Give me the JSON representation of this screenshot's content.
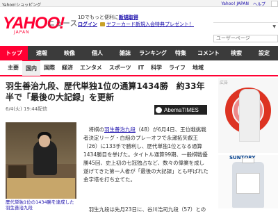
{
  "topbar": {
    "left_text": "Yahoo!ショッピング",
    "right_links": [
      "Yahoo! JAPAN",
      "ヘルプ"
    ]
  },
  "header": {
    "logo": "YAHOO!",
    "logo_sub": "JAPAN",
    "service_name": "ニュース",
    "promo_line1_prefix": "1Dでもっと便利に",
    "promo_line1_link": "新規取得",
    "promo_line2_link": "ログイン",
    "promo_line2_text": "ヤフーカード新規入会特典プレゼント！",
    "user_dropdown": "",
    "user_input_placeholder": "ユーザーページ"
  },
  "nav": {
    "items": [
      "トップ",
      "速報",
      "映像",
      "個人",
      "雑誌",
      "ランキング",
      "特集",
      "コメント",
      "検索",
      "設定"
    ],
    "active_index": 0
  },
  "subnav": {
    "items": [
      "主要",
      "国内",
      "国際",
      "経済",
      "エンタメ",
      "スポーツ",
      "IT",
      "科学",
      "ライフ",
      "地域"
    ],
    "active_index": 1
  },
  "article": {
    "title": "羽生善治九段、歴代単独1位の通算1434勝　約33年半で「最後の大記録」を更新",
    "date": "6/4(火) 19:44配信",
    "source_logo": "AbemaTIMES",
    "photo_caption": "歴代単独1位の1434勝を達成した羽生善治九段",
    "paragraph1_prefix": "　将棋の",
    "paragraph1_link": "羽生善治九段",
    "paragraph1_rest": "（48）が6月4日、王位戦挑戦者決定リーグ・白組のプレーオフで永瀬拓矢叡王（26）に133手で勝利し、歴代単独1位となる通算1434勝目を挙げた。タイトル通算99期、一般棋戦優勝45回、史上初の七冠独占など、数々の偉業を成し遂げてきた第一人者が「最後の大記録」とも呼ばれた金字塔を打ち立てた。",
    "paragraph2": "　羽生九段は先月23日に、谷川浩司九段（57）との"
  },
  "ads": {
    "top_label": "広告",
    "bottom_brand": "SUNTORY"
  }
}
